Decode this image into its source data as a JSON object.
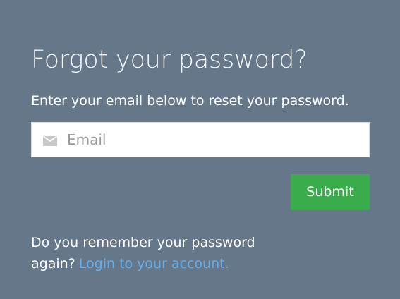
{
  "form": {
    "title": "Forgot your password?",
    "subtitle": "Enter your email below to reset your password.",
    "email_placeholder": "Email",
    "email_icon": "envelope-icon",
    "submit_label": "Submit",
    "remember_text": "Do you remember your password again?",
    "login_link_text": "Login to your account."
  },
  "colors": {
    "background": "#667789",
    "input_background": "#ffffff",
    "submit_background": "#3bac4b",
    "link": "#63b0ee",
    "icon": "#c7c7c7"
  }
}
